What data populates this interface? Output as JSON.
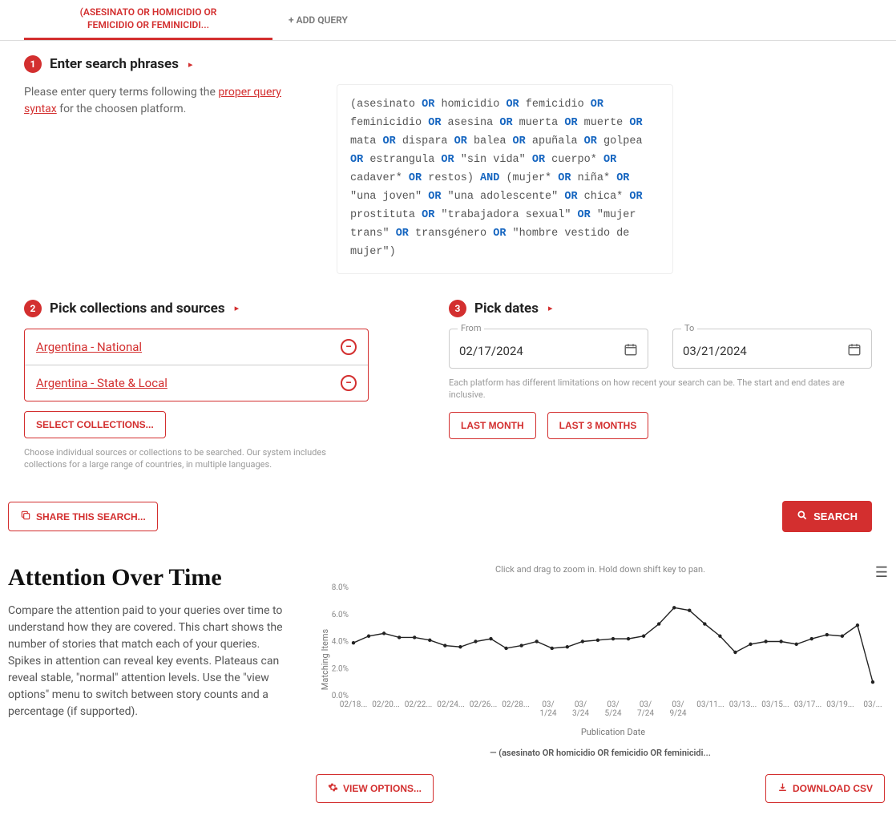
{
  "tabs": {
    "active": "(ASESINATO OR HOMICIDIO OR FEMICIDIO OR FEMINICIDI...",
    "add": "+ ADD QUERY"
  },
  "step1": {
    "title": "Enter search phrases",
    "helper_pre": "Please enter query terms following the ",
    "helper_link": "proper query syntax",
    "helper_post": " for the choosen platform.",
    "query_tokens": [
      {
        "t": "("
      },
      {
        "t": "asesinato"
      },
      {
        "k": "OR"
      },
      {
        "t": "homicidio"
      },
      {
        "k": "OR"
      },
      {
        "t": "femicidio"
      },
      {
        "k": "OR"
      },
      {
        "t": "feminicidio"
      },
      {
        "k": "OR"
      },
      {
        "t": "asesina"
      },
      {
        "k": "OR"
      },
      {
        "t": "muerta"
      },
      {
        "k": "OR"
      },
      {
        "t": "muerte"
      },
      {
        "k": "OR"
      },
      {
        "t": "mata"
      },
      {
        "k": "OR"
      },
      {
        "t": "dispara"
      },
      {
        "k": "OR"
      },
      {
        "t": "balea"
      },
      {
        "k": "OR"
      },
      {
        "t": "apuñala"
      },
      {
        "k": "OR"
      },
      {
        "t": "golpea"
      },
      {
        "k": "OR"
      },
      {
        "t": "estrangula"
      },
      {
        "k": "OR"
      },
      {
        "t": "\"sin vida\""
      },
      {
        "k": "OR"
      },
      {
        "t": "cuerpo*"
      },
      {
        "k": "OR"
      },
      {
        "t": "cadaver*"
      },
      {
        "k": "OR"
      },
      {
        "t": "restos)"
      },
      {
        "k": "AND"
      },
      {
        "t": "(mujer*"
      },
      {
        "k": "OR"
      },
      {
        "t": "niña*"
      },
      {
        "k": "OR"
      },
      {
        "t": "\"una joven\""
      },
      {
        "k": "OR"
      },
      {
        "t": "\"una adolescente\""
      },
      {
        "k": "OR"
      },
      {
        "t": "chica*"
      },
      {
        "k": "OR"
      },
      {
        "t": "prostituta"
      },
      {
        "k": "OR"
      },
      {
        "t": "\"trabajadora sexual\""
      },
      {
        "k": "OR"
      },
      {
        "t": "\"mujer trans\""
      },
      {
        "k": "OR"
      },
      {
        "t": "transgénero"
      },
      {
        "k": "OR"
      },
      {
        "t": "\"hombre vestido de mujer\")"
      }
    ]
  },
  "step2": {
    "title": "Pick collections and sources",
    "collections": [
      {
        "name": "Argentina - National"
      },
      {
        "name": "Argentina - State & Local"
      }
    ],
    "select_btn": "SELECT COLLECTIONS...",
    "help": "Choose individual sources or collections to be searched. Our system includes collections for a large range of countries, in multiple languages."
  },
  "step3": {
    "title": "Pick dates",
    "from_label": "From",
    "from_value": "02/17/2024",
    "to_label": "To",
    "to_value": "03/21/2024",
    "help": "Each platform has different limitations on how recent your search can be. The start and end dates are inclusive.",
    "last_month": "LAST MONTH",
    "last_3_months": "LAST 3 MONTHS"
  },
  "actions": {
    "share": "SHARE THIS SEARCH...",
    "search": "SEARCH"
  },
  "results": {
    "title": "Attention Over Time",
    "desc": "Compare the attention paid to your queries over time to understand how they are covered. This chart shows the number of stories that match each of your queries. Spikes in attention can reveal key events. Plateaus can reveal stable, \"normal\" attention levels. Use the \"view options\" menu to switch between story counts and a percentage (if supported).",
    "hint": "Click and drag to zoom in. Hold down shift key to pan.",
    "legend": "— (asesinato OR homicidio OR femicidio OR feminicidi...",
    "view_options": "VIEW OPTIONS...",
    "download": "DOWNLOAD CSV"
  },
  "chart_data": {
    "type": "line",
    "title": "",
    "xlabel": "Publication Date",
    "ylabel": "Matching Items",
    "ylim": [
      0,
      8
    ],
    "y_ticks": [
      "0.0%",
      "2.0%",
      "4.0%",
      "6.0%",
      "8.0%"
    ],
    "x_ticks": [
      "02/18...",
      "02/20...",
      "02/22...",
      "02/24...",
      "02/26...",
      "02/28...",
      "03/ 1/24",
      "03/ 3/24",
      "03/ 5/24",
      "03/ 7/24",
      "03/ 9/24",
      "03/11...",
      "03/13...",
      "03/15...",
      "03/17...",
      "03/19...",
      "03/..."
    ],
    "series": [
      {
        "name": "(asesinato OR homicidio OR femicidio OR feminicidi...",
        "values": [
          3.9,
          4.4,
          4.6,
          4.3,
          4.3,
          4.1,
          3.7,
          3.6,
          4.0,
          4.2,
          3.5,
          3.7,
          4.0,
          3.5,
          3.6,
          4.0,
          4.1,
          4.2,
          4.2,
          4.4,
          5.3,
          6.5,
          6.3,
          5.3,
          4.4,
          3.2,
          3.8,
          4.0,
          4.0,
          3.8,
          4.2,
          4.5,
          4.4,
          5.2,
          1.0
        ]
      }
    ]
  }
}
